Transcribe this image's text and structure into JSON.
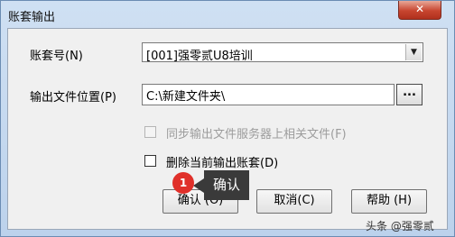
{
  "window": {
    "title": "账套输出",
    "close_glyph": "✕"
  },
  "form": {
    "account_label": "账套号(N)",
    "account_value": "[001]强零贰U8培训",
    "path_label": "输出文件位置(P)",
    "path_value": "C:\\新建文件夹\\",
    "browse_label": "...",
    "sync_checkbox_label": "同步输出文件服务器上相关文件(F)",
    "delete_checkbox_label": "删除当前输出账套(D)"
  },
  "buttons": {
    "ok": "确认 (O)",
    "cancel": "取消(C)",
    "help": "帮助 (H)"
  },
  "annotation": {
    "badge_number": "1",
    "tooltip_text": "确认"
  },
  "watermark": "头条 @强零贰",
  "colors": {
    "close_button": "#c7452f",
    "badge": "#e0302a",
    "tooltip": "#3a3a3a"
  }
}
